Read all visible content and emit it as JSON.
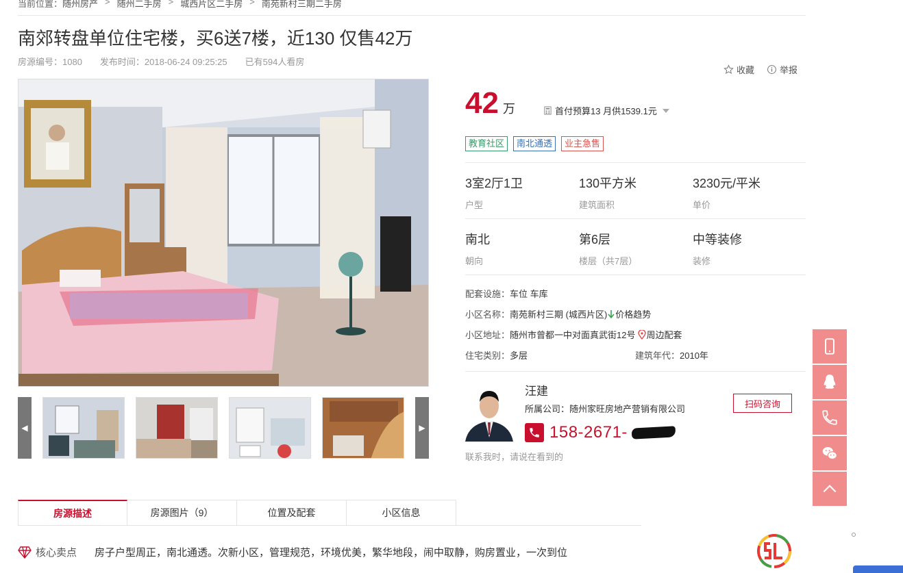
{
  "breadcrumb": {
    "prefix": "当前位置：",
    "items": [
      "随州房产",
      "随州二手房",
      "城西片区二手房",
      "南苑新村三期二手房"
    ],
    "separator": ">"
  },
  "listing": {
    "title": "南郊转盘单位住宅楼，买6送7楼，近130 仅售42万",
    "code": "房源编号：1080",
    "published": "发布时间：2018-06-24 09:25:25",
    "views": "已有594人看房"
  },
  "actions": {
    "favorite": "收藏",
    "report": "举报"
  },
  "price": {
    "value": "42",
    "unit": "万",
    "budget": "首付预算13 月供1539.1元"
  },
  "tags": [
    {
      "label": "教育社区",
      "color": "#3a9a6a"
    },
    {
      "label": "南北通透",
      "color": "#3b6fb0"
    },
    {
      "label": "业主急售",
      "color": "#d9534f"
    }
  ],
  "specs": [
    {
      "value": "3室2厅1卫",
      "key": "户型"
    },
    {
      "value": "130平方米",
      "key": "建筑面积"
    },
    {
      "value": "3230元/平米",
      "key": "单价"
    },
    {
      "value": "南北",
      "key": "朝向"
    },
    {
      "value": "第6层",
      "key": "楼层（共7层）"
    },
    {
      "value": "中等装修",
      "key": "装修"
    }
  ],
  "details": {
    "facilities_label": "配套设施：",
    "facilities": "车位 车库",
    "community_label": "小区名称：",
    "community": "南苑新村三期 (城西片区)",
    "price_trend": "价格趋势",
    "address_label": "小区地址：",
    "address": "随州市曾都一中对面真武街12号",
    "nearby": "周边配套",
    "type_label": "住宅类别：",
    "type": "多层",
    "year_label": "建筑年代：",
    "year": "2010年"
  },
  "agent": {
    "name": "汪建",
    "company": "所属公司：随州家旺房地产营销有限公司",
    "phone": "158-2671-",
    "scan_button": "扫码咨询",
    "hint": "联系我时，请说在看到的"
  },
  "tabs": [
    {
      "label": "房源描述",
      "active": true
    },
    {
      "label": "房源图片（9）",
      "active": false
    },
    {
      "label": "位置及配套",
      "active": false
    },
    {
      "label": "小区信息",
      "active": false
    }
  ],
  "selling_point": {
    "heading": "核心卖点",
    "text": "房子户型周正，南北通透。次新小区，管理规范，环境优美，繁华地段，闹中取静，购房置业，一次到位"
  },
  "float_bar": [
    "mobile-icon",
    "qq-icon",
    "phone-icon",
    "wechat-icon",
    "back-to-top-icon"
  ],
  "colors": {
    "accent": "#c8102e",
    "float": "#f08c8c"
  }
}
